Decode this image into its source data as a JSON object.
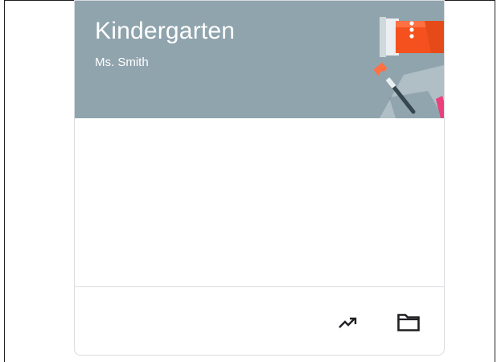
{
  "course": {
    "title": "Kindergarten",
    "teacher": "Ms. Smith",
    "header_color": "#90a4ae",
    "illustration": "paint-tube-and-brush"
  },
  "card_menu": {
    "icon": "more-vert-icon"
  },
  "footer_actions": [
    {
      "icon": "trending-up-icon"
    },
    {
      "icon": "folder-icon"
    }
  ]
}
